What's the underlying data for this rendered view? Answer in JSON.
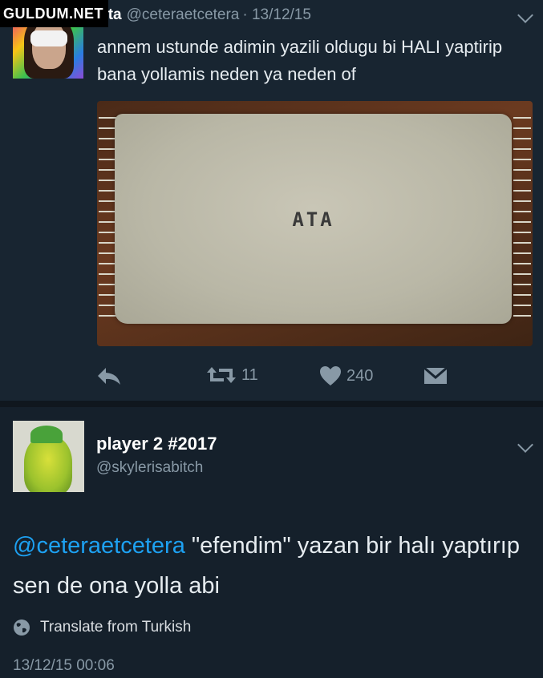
{
  "watermark": "GULDUM.NET",
  "tweet1": {
    "name": "Ata",
    "handle": "@ceteraetcetera",
    "date": "· 13/12/15",
    "text": "annem ustunde adimin yazili oldugu bi HALI yaptirip bana yollamis neden ya neden of",
    "rug_text": "ATA",
    "retweets": "11",
    "likes": "240"
  },
  "tweet2": {
    "name": "player 2 #2017",
    "handle": "@skylerisabitch",
    "mention": "@ceteraetcetera",
    "text": " \"efendim\" yazan bir halı yaptırıp sen de ona yolla abi",
    "translate": "Translate from Turkish",
    "timestamp": "13/12/15 00:06"
  },
  "colors": {
    "background": "#15202b",
    "accent": "#1da1f2",
    "muted": "#8899a6"
  },
  "icons": [
    "reply-icon",
    "retweet-icon",
    "heart-icon",
    "message-icon",
    "chevron-down-icon",
    "globe-icon"
  ]
}
